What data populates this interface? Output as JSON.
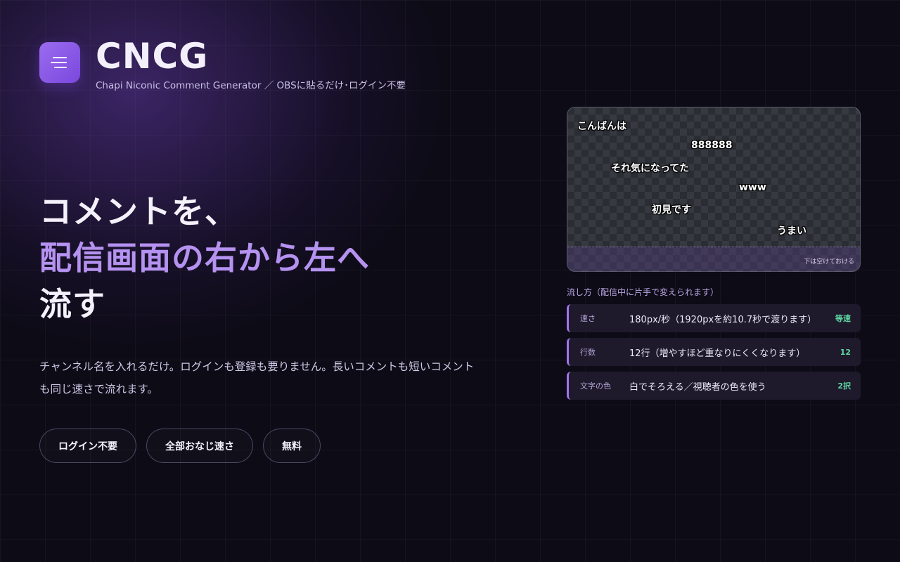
{
  "header": {
    "title": "CNCG",
    "subtitle": "Chapi Niconic Comment Generator ／ OBSに貼るだけ･ログイン不要",
    "logo_icon": "menu-lines-icon"
  },
  "hero": {
    "line1": "コメントを、",
    "line2": "配信画面の右から左へ",
    "line3": "流す"
  },
  "lead": "チャンネル名を入れるだけ。ログインも登録も要りません。長いコメントも短いコメントも同じ速さで流れます。",
  "pills": [
    {
      "label": "ログイン不要"
    },
    {
      "label": "全部おなじ速さ"
    },
    {
      "label": "無料"
    }
  ],
  "preview": {
    "comments": [
      "こんばんは",
      "888888",
      "それ気になってた",
      "www",
      "初見です",
      "うまい"
    ],
    "bottom_note": "下は空けておける"
  },
  "settings": {
    "label": "流し方（配信中に片手で変えられます）",
    "items": [
      {
        "key": "速さ",
        "value": "180px/秒（1920pxを約10.7秒で渡ります）",
        "tag": "等速"
      },
      {
        "key": "行数",
        "value": "12行（増やすほど重なりにくくなります）",
        "tag": "12"
      },
      {
        "key": "文字の色",
        "value": "白でそろえる／視聴者の色を使う",
        "tag": "2択"
      }
    ]
  },
  "colors": {
    "background": "#0d0b16",
    "accent": "#b592f0",
    "logo": "#8b5cf6",
    "tag": "#5fd4a0"
  }
}
